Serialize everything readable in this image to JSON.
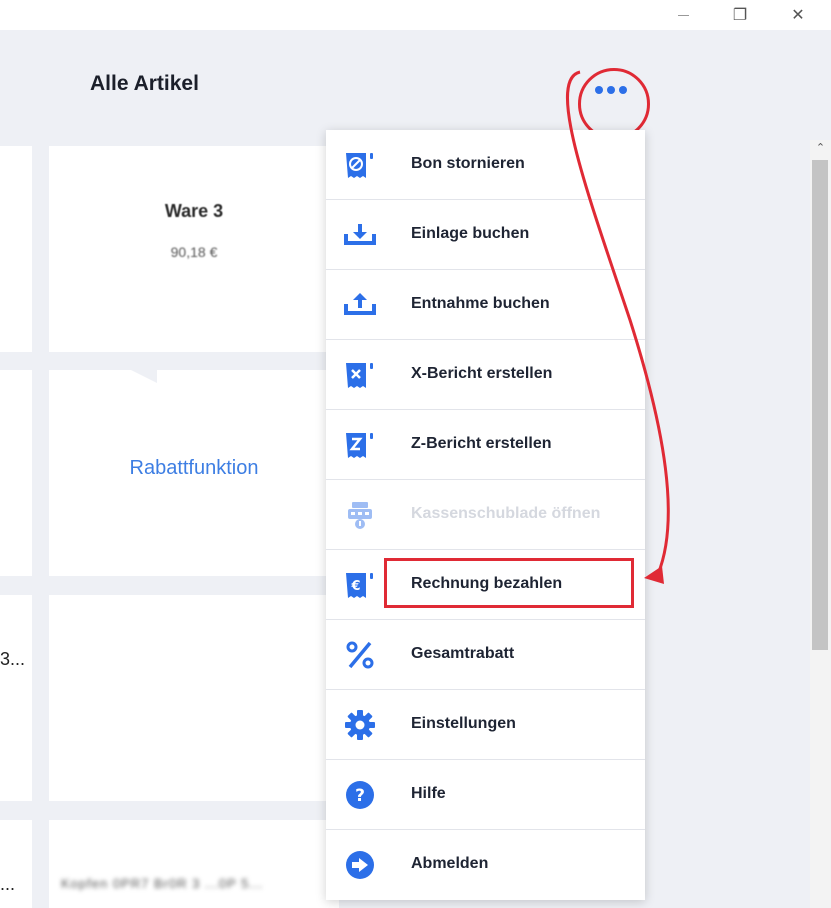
{
  "window": {
    "controls": {
      "minimize": "",
      "maximize": "❐",
      "close": "✕"
    }
  },
  "header": {
    "title": "Alle Artikel"
  },
  "tiles": {
    "product": {
      "name": "Ware 3",
      "price": "90,18 €"
    },
    "discount_function": "Rabattfunktion",
    "truncated_left_1": "3...",
    "truncated_left_2": "...",
    "blurred_bottom": "Kopfen 0PR7 Br0R 3 ...0P 5..."
  },
  "menu": {
    "items": [
      {
        "label": "Bon stornieren",
        "icon": "receipt-cancel-icon",
        "enabled": true
      },
      {
        "label": "Einlage buchen",
        "icon": "tray-download-icon",
        "enabled": true
      },
      {
        "label": "Entnahme buchen",
        "icon": "tray-upload-icon",
        "enabled": true
      },
      {
        "label": "X-Bericht erstellen",
        "icon": "x-report-icon",
        "enabled": true
      },
      {
        "label": "Z-Bericht erstellen",
        "icon": "z-report-icon",
        "enabled": true
      },
      {
        "label": "Kassenschublade öffnen",
        "icon": "cash-drawer-icon",
        "enabled": false
      },
      {
        "label": "Rechnung bezahlen",
        "icon": "euro-receipt-icon",
        "enabled": true
      },
      {
        "label": "Gesamtrabatt",
        "icon": "percent-icon",
        "enabled": true
      },
      {
        "label": "Einstellungen",
        "icon": "gear-icon",
        "enabled": true
      },
      {
        "label": "Hilfe",
        "icon": "help-icon",
        "enabled": true
      },
      {
        "label": "Abmelden",
        "icon": "logout-icon",
        "enabled": true
      }
    ]
  },
  "colors": {
    "accent": "#2c6fe8",
    "highlight": "#e02a35",
    "background": "#eef0f5",
    "disabled_text": "#d5d8df",
    "link_blue": "#3d7ee3"
  }
}
